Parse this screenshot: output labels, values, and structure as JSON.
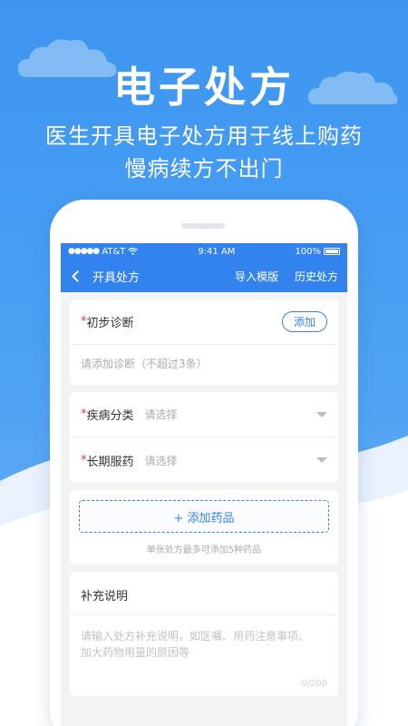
{
  "hero": {
    "title": "电子处方",
    "subtitle_line1": "医生开具电子处方用于线上购药",
    "subtitle_line2": "慢病续方不出门"
  },
  "status_bar": {
    "carrier": "AT&T",
    "time": "9:41 AM",
    "battery": "100%"
  },
  "nav": {
    "title": "开具处方",
    "action_import": "导入模版",
    "action_history": "历史处方"
  },
  "diagnosis": {
    "required_mark": "*",
    "label": "初步诊断",
    "add_button": "添加",
    "placeholder": "请添加诊断（不超过3条）"
  },
  "disease_category": {
    "required_mark": "*",
    "label": "疾病分类",
    "value": "请选择"
  },
  "long_term_med": {
    "required_mark": "*",
    "label": "长期服药",
    "value": "请选择"
  },
  "drugs": {
    "add_button": "+ 添加药品",
    "note": "单张处方最多可添加5种药品"
  },
  "supplement": {
    "title": "补充说明",
    "placeholder_line1": "请输入处方补充说明，如医嘱、用药注意事项、",
    "placeholder_line2": "加大药物用量的原因等",
    "counter": "0/200"
  },
  "colors": {
    "primary": "#3383ee",
    "background_blue": "#4aa0f3",
    "required": "#e53935"
  }
}
